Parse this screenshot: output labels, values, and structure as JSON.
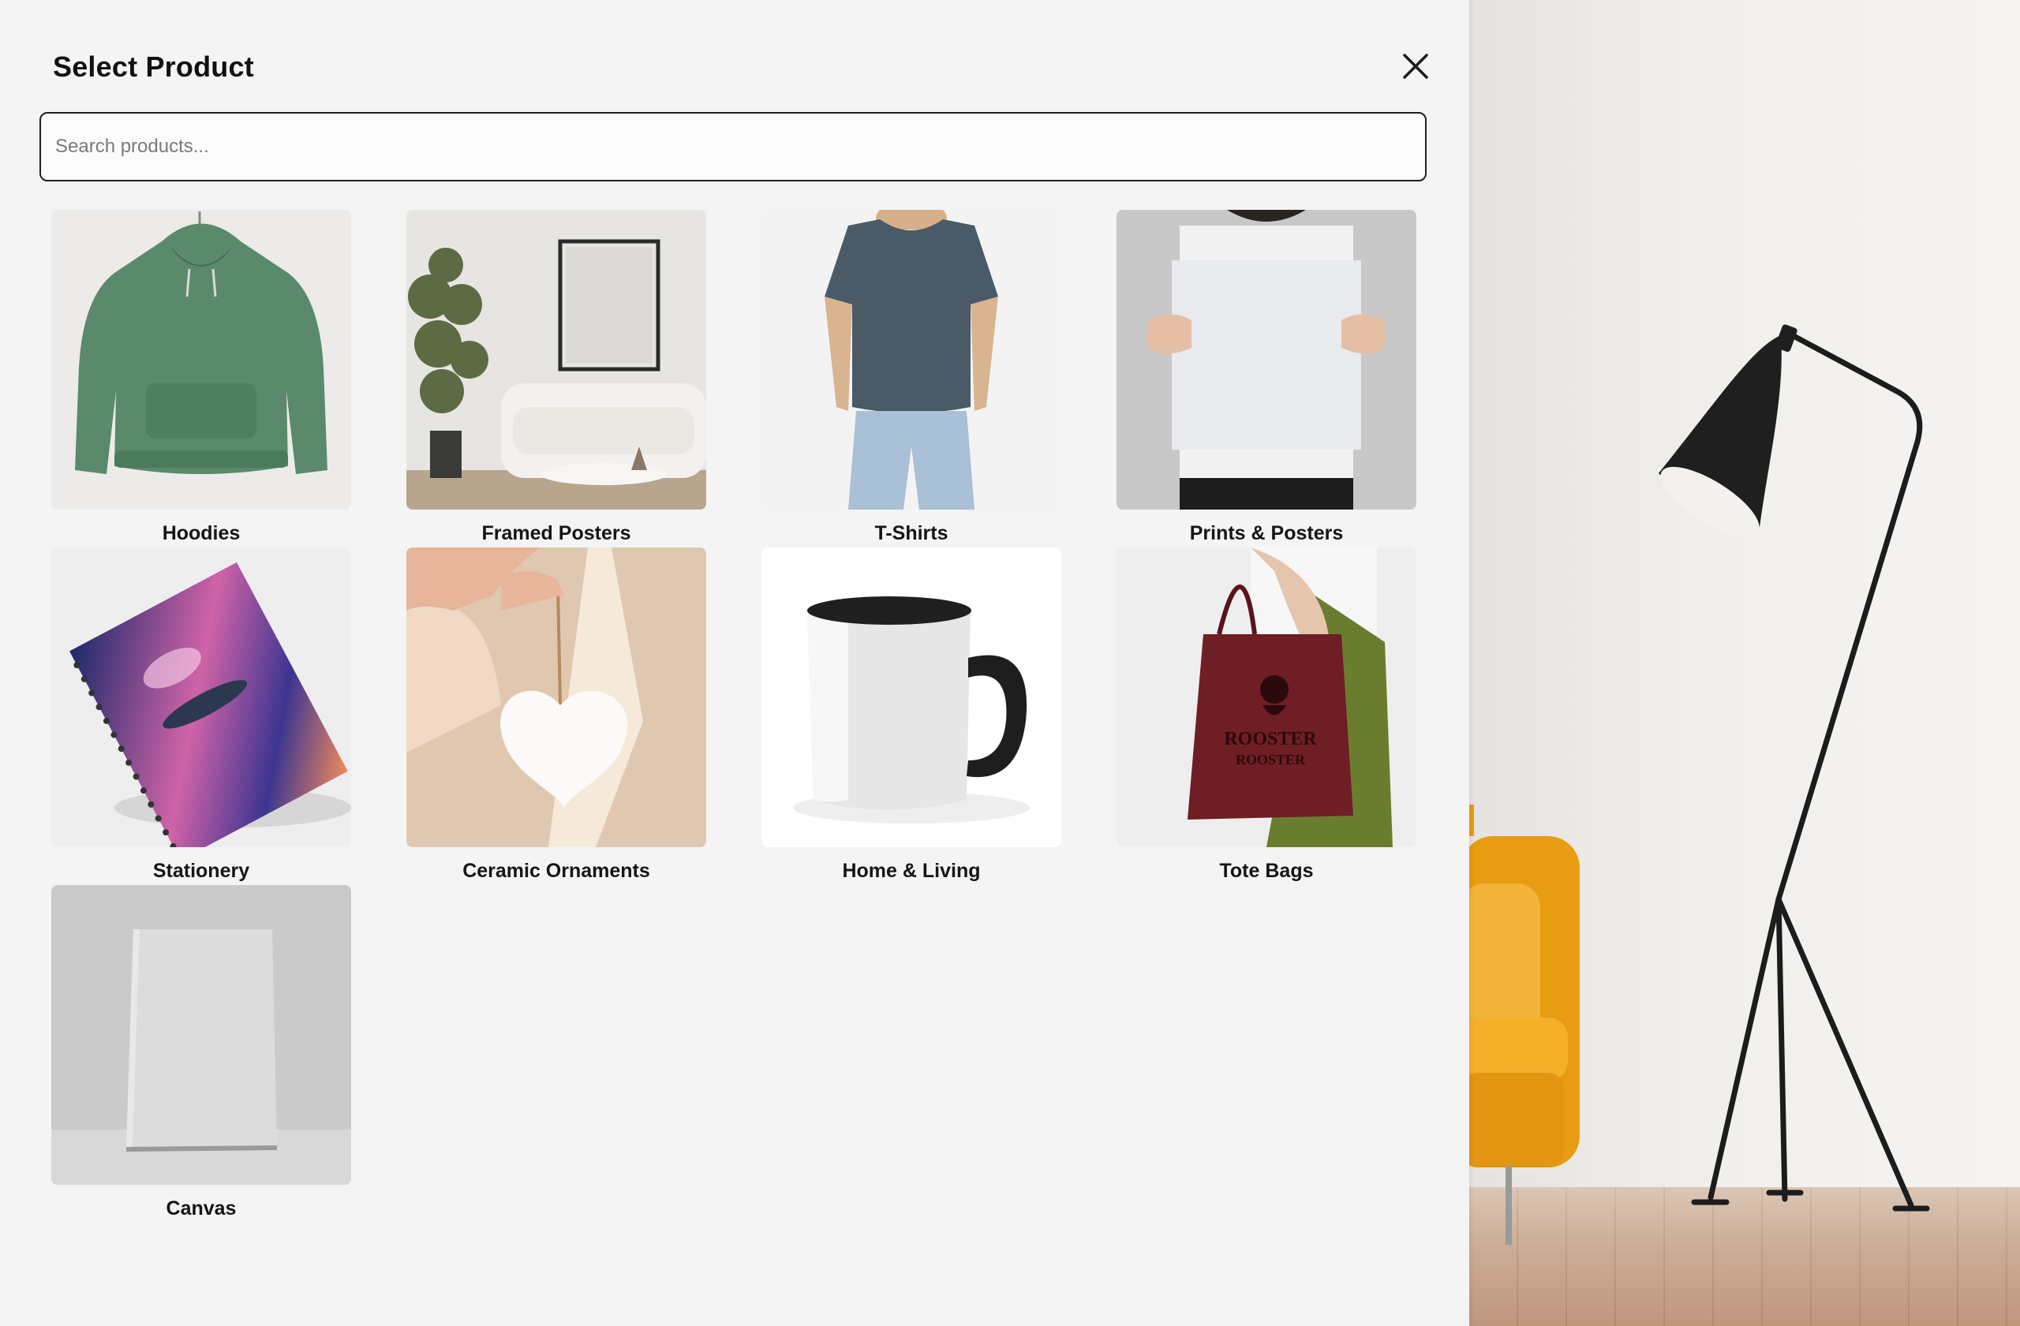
{
  "modal": {
    "title": "Select Product",
    "close_icon": "close-icon",
    "search_placeholder": "Search products...",
    "search_value": ""
  },
  "products": [
    {
      "label": "Hoodies",
      "image": "hoodie-image"
    },
    {
      "label": "Framed Posters",
      "image": "framed-poster-image"
    },
    {
      "label": "T-Shirts",
      "image": "tshirt-image"
    },
    {
      "label": "Prints & Posters",
      "image": "print-poster-image"
    },
    {
      "label": "Stationery",
      "image": "notebook-image"
    },
    {
      "label": "Ceramic Ornaments",
      "image": "heart-ornament-image"
    },
    {
      "label": "Home & Living",
      "image": "mug-image"
    },
    {
      "label": "Tote Bags",
      "image": "tote-bag-image"
    },
    {
      "label": "Canvas",
      "image": "canvas-image"
    }
  ],
  "tote_print": {
    "line1": "ROOSTER",
    "line2": "ROOSTER"
  },
  "colors": {
    "panel_bg": "#f4f4f4",
    "hoodie": "#5a8a6b",
    "tshirt": "#4a5a66",
    "tote": "#6e1e24",
    "chair": "#f0a81c"
  }
}
